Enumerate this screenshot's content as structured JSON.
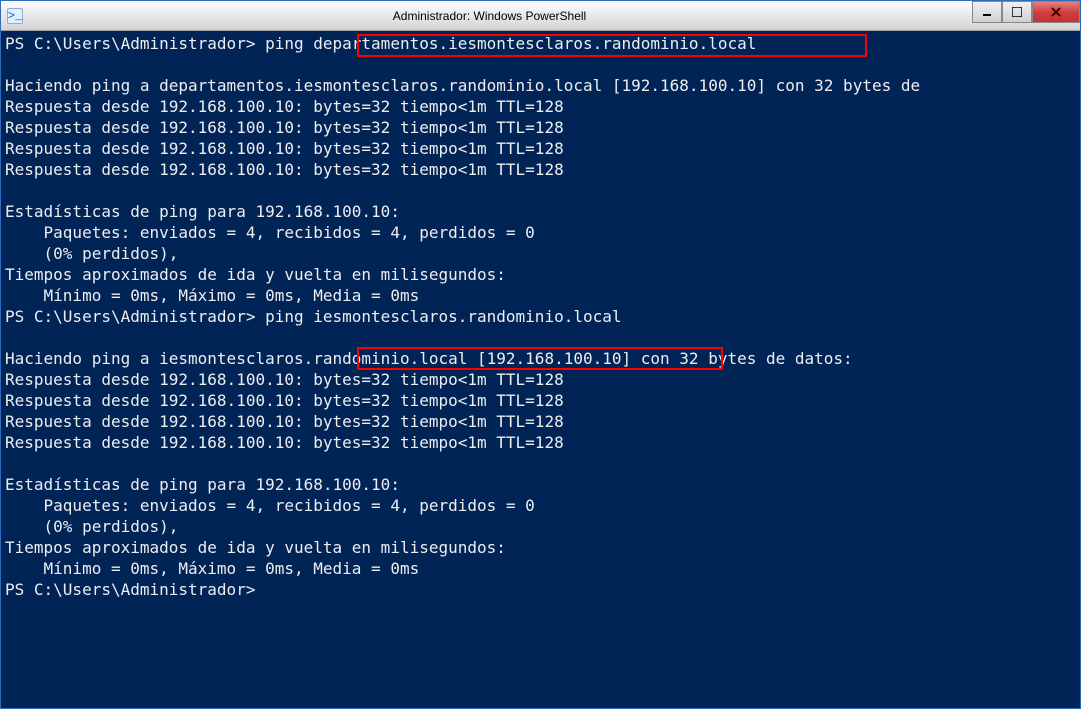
{
  "titlebar": {
    "title": "Administrador: Windows PowerShell"
  },
  "terminal": {
    "line01": "PS C:\\Users\\Administrador> ping departamentos.iesmontesclaros.randominio.local",
    "line02": "",
    "line03": "Haciendo ping a departamentos.iesmontesclaros.randominio.local [192.168.100.10] con 32 bytes de",
    "line04": "Respuesta desde 192.168.100.10: bytes=32 tiempo<1m TTL=128",
    "line05": "Respuesta desde 192.168.100.10: bytes=32 tiempo<1m TTL=128",
    "line06": "Respuesta desde 192.168.100.10: bytes=32 tiempo<1m TTL=128",
    "line07": "Respuesta desde 192.168.100.10: bytes=32 tiempo<1m TTL=128",
    "line08": "",
    "line09": "Estadísticas de ping para 192.168.100.10:",
    "line10": "    Paquetes: enviados = 4, recibidos = 4, perdidos = 0",
    "line11": "    (0% perdidos),",
    "line12": "Tiempos aproximados de ida y vuelta en milisegundos:",
    "line13": "    Mínimo = 0ms, Máximo = 0ms, Media = 0ms",
    "line14": "PS C:\\Users\\Administrador> ping iesmontesclaros.randominio.local",
    "line15": "",
    "line16": "Haciendo ping a iesmontesclaros.randominio.local [192.168.100.10] con 32 bytes de datos:",
    "line17": "Respuesta desde 192.168.100.10: bytes=32 tiempo<1m TTL=128",
    "line18": "Respuesta desde 192.168.100.10: bytes=32 tiempo<1m TTL=128",
    "line19": "Respuesta desde 192.168.100.10: bytes=32 tiempo<1m TTL=128",
    "line20": "Respuesta desde 192.168.100.10: bytes=32 tiempo<1m TTL=128",
    "line21": "",
    "line22": "Estadísticas de ping para 192.168.100.10:",
    "line23": "    Paquetes: enviados = 4, recibidos = 4, perdidos = 0",
    "line24": "    (0% perdidos),",
    "line25": "Tiempos aproximados de ida y vuelta en milisegundos:",
    "line26": "    Mínimo = 0ms, Máximo = 0ms, Media = 0ms",
    "line27": "PS C:\\Users\\Administrador>"
  },
  "highlights": {
    "box1": "departamentos.iesmontesclaros.randominio.local",
    "box2": "iesmontesclaros.randominio.local"
  }
}
